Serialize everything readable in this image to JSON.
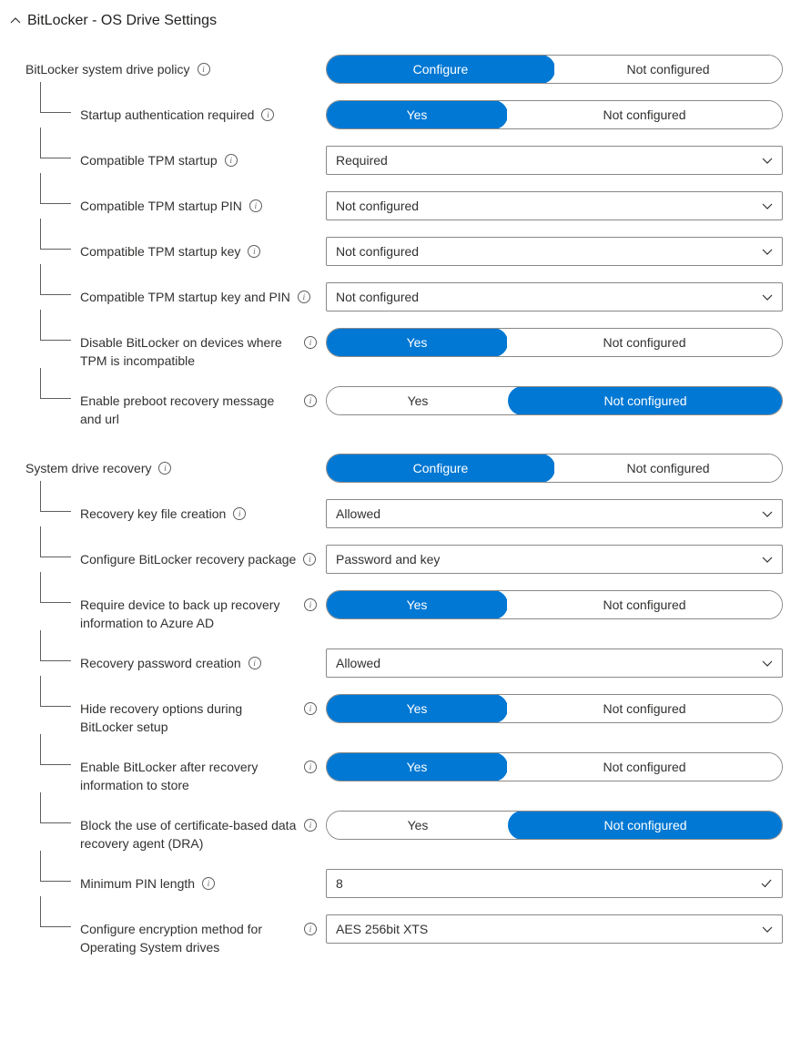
{
  "section_title": "BitLocker - OS Drive Settings",
  "toggle_labels": {
    "configure": "Configure",
    "not_configured": "Not configured",
    "yes": "Yes"
  },
  "rows": {
    "policy": {
      "label": "BitLocker system drive policy",
      "left": "Configure",
      "right": "Not configured",
      "selected": "left"
    },
    "startup_auth": {
      "label": "Startup authentication required",
      "left": "Yes",
      "right": "Not configured",
      "selected": "left"
    },
    "tpm_startup": {
      "label": "Compatible TPM startup",
      "value": "Required"
    },
    "tpm_pin": {
      "label": "Compatible TPM startup PIN",
      "value": "Not configured"
    },
    "tpm_key": {
      "label": "Compatible TPM startup key",
      "value": "Not configured"
    },
    "tpm_key_pin": {
      "label": "Compatible TPM startup key and PIN",
      "value": "Not configured"
    },
    "disable_no_tpm": {
      "label": "Disable BitLocker on devices where TPM is incompatible",
      "left": "Yes",
      "right": "Not configured",
      "selected": "left"
    },
    "preboot_msg": {
      "label": "Enable preboot recovery message and url",
      "left": "Yes",
      "right": "Not configured",
      "selected": "right"
    },
    "sys_recovery": {
      "label": "System drive recovery",
      "left": "Configure",
      "right": "Not configured",
      "selected": "left"
    },
    "recovery_key_file": {
      "label": "Recovery key file creation",
      "value": "Allowed"
    },
    "recovery_pkg": {
      "label": "Configure BitLocker recovery package",
      "value": "Password and key"
    },
    "backup_aad": {
      "label": "Require device to back up recovery information to Azure AD",
      "left": "Yes",
      "right": "Not configured",
      "selected": "left"
    },
    "recovery_pwd": {
      "label": "Recovery password creation",
      "value": "Allowed"
    },
    "hide_recovery": {
      "label": "Hide recovery options during BitLocker setup",
      "left": "Yes",
      "right": "Not configured",
      "selected": "left"
    },
    "enable_after_store": {
      "label": "Enable BitLocker after recovery information to store",
      "left": "Yes",
      "right": "Not configured",
      "selected": "left"
    },
    "block_dra": {
      "label": "Block the use of certificate-based data recovery agent (DRA)",
      "left": "Yes",
      "right": "Not configured",
      "selected": "right"
    },
    "min_pin": {
      "label": "Minimum PIN length",
      "value": "8"
    },
    "enc_method": {
      "label": "Configure encryption method for Operating System drives",
      "value": "AES 256bit XTS"
    }
  }
}
